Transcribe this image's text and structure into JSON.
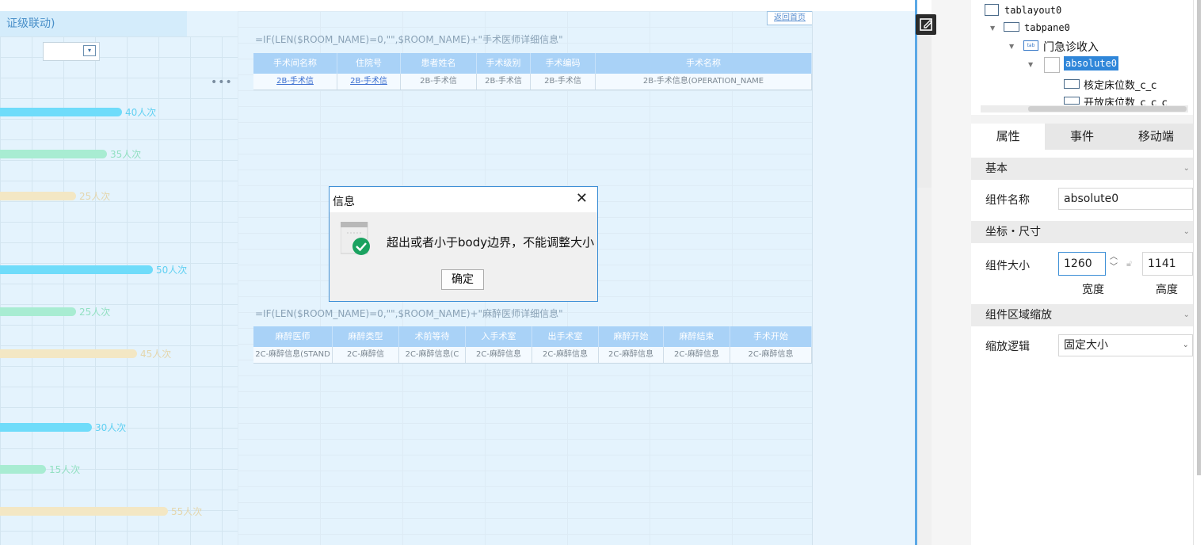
{
  "canvas": {
    "left_title": "证级联动)",
    "more_dots": "•••",
    "toplink": "返回首页",
    "formula1": "=IF(LEN($ROOM_NAME)=0,\"\",$ROOM_NAME)+\"手术医师详细信息\"",
    "formula2": "=IF(LEN($ROOM_NAME)=0,\"\",$ROOM_NAME)+\"麻醉医师详细信息\"",
    "table1": {
      "headers": [
        "手术间名称",
        "住院号",
        "患者姓名",
        "手术级别",
        "手术编码",
        "手术名称"
      ],
      "row": [
        "2B-手术信",
        "2B-手术信",
        "2B-手术信",
        "2B-手术信",
        "2B-手术信",
        "2B-手术信息(OPERATION_NAME"
      ]
    },
    "table2": {
      "headers": [
        "麻醉医师",
        "麻醉类型",
        "术前等待",
        "入手术室",
        "出手术室",
        "麻醉开始",
        "麻醉结束",
        "手术开始"
      ],
      "row": [
        "2C-麻醉信息(STAND",
        "2C-麻醉信",
        "2C-麻醉信息(C",
        "2C-麻醉信息",
        "2C-麻醉信息",
        "2C-麻醉信息",
        "2C-麻醉信息",
        "2C-麻醉信息"
      ]
    },
    "bars": [
      {
        "label": "40人次",
        "value": 40,
        "color": "#6fdcfa"
      },
      {
        "label": "35人次",
        "value": 35,
        "color": "#a8ecd2"
      },
      {
        "label": "25人次",
        "value": 25,
        "color": "#f3e7c4"
      },
      {
        "label": "50人次",
        "value": 50,
        "color": "#6fdcfa"
      },
      {
        "label": "25人次",
        "value": 25,
        "color": "#a8ecd2"
      },
      {
        "label": "45人次",
        "value": 45,
        "color": "#f3e7c4"
      },
      {
        "label": "30人次",
        "value": 30,
        "color": "#6fdcfa"
      },
      {
        "label": "15人次",
        "value": 15,
        "color": "#a8ecd2"
      },
      {
        "label": "55人次",
        "value": 55,
        "color": "#f3e7c4"
      }
    ]
  },
  "dialog": {
    "title": "信息",
    "message": "超出或者小于body边界，不能调整大小",
    "ok_label": "确定",
    "close_glyph": "✕"
  },
  "tree": {
    "items": [
      {
        "label": "tablayout0"
      },
      {
        "label": "tabpane0"
      },
      {
        "label": "门急诊收入"
      },
      {
        "label": "absolute0"
      },
      {
        "label": "核定床位数_c_c"
      },
      {
        "label": "开放床位数_c_c_c"
      }
    ]
  },
  "panel": {
    "tabs": [
      "属性",
      "事件",
      "移动端"
    ],
    "section_basic": "基本",
    "name_label": "组件名称",
    "name_value": "absolute0",
    "section_coord": "坐标・尺寸",
    "size_label": "组件大小",
    "width_value": "1260",
    "height_value": "1141",
    "width_caption": "宽度",
    "height_caption": "高度",
    "section_scale": "组件区域缩放",
    "scale_label": "缩放逻辑",
    "scale_value": "固定大小"
  },
  "colors": {
    "accent": "#3d8fd6",
    "canvas_bg": "#e4f3fd",
    "table_header": "#a9d2f7",
    "success": "#1aa260"
  }
}
